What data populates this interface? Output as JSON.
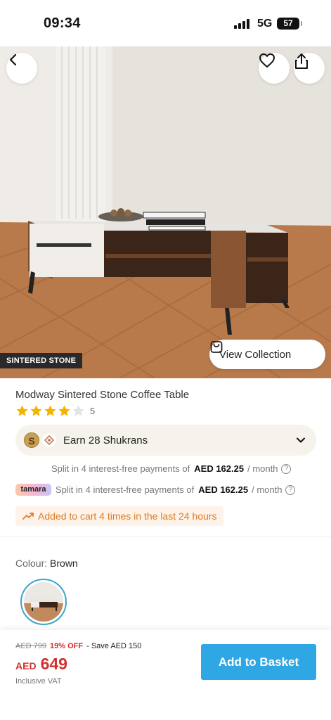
{
  "status_bar": {
    "time": "09:34",
    "network": "5G",
    "battery": "57"
  },
  "hero": {
    "badge": "SINTERED STONE",
    "view_collection": "View Collection"
  },
  "product": {
    "title": "Modway Sintered Stone Coffee Table",
    "rating": 4,
    "rating_max": 5,
    "rating_count": "5"
  },
  "shukran": {
    "text": "Earn 28 Shukrans"
  },
  "installments": [
    {
      "text": "Split in 4 interest-free payments of",
      "amount": "AED 162.25",
      "suffix": "/ month"
    },
    {
      "provider": "tamara",
      "text": "Split in 4 interest-free payments of",
      "amount": "AED 162.25",
      "suffix": "/ month"
    }
  ],
  "cart_alert": "Added to cart 4 times in the last 24 hours",
  "colour": {
    "label": "Colour:",
    "value": "Brown"
  },
  "pricing": {
    "old_price": "AED 799",
    "discount": "19% OFF",
    "save": "- Save AED 150",
    "currency": "AED",
    "price": "649",
    "vat_note": "Inclusive VAT"
  },
  "actions": {
    "add_to_basket": "Add to Basket"
  },
  "colors": {
    "accent": "#2fa7e4",
    "price_red": "#d32f2f",
    "alert_orange": "#e07b1f"
  }
}
